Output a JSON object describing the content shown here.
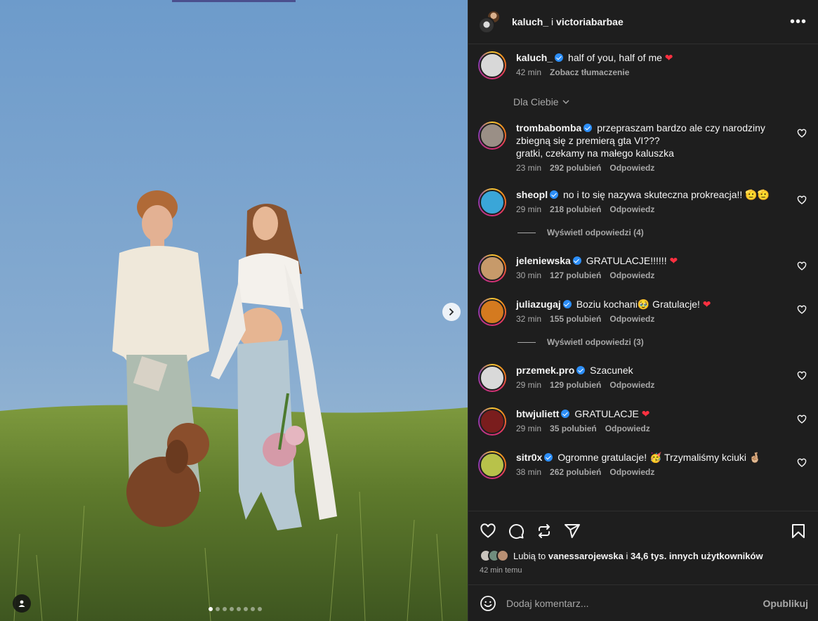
{
  "post": {
    "authors": [
      "kaluch_",
      "victoriabarbae"
    ],
    "authors_joiner": "i",
    "more_icon": "more-horizontal-icon"
  },
  "caption": {
    "username": "kaluch_",
    "text": "half of you, half of me",
    "emoji": "❤",
    "time": "42 min",
    "translate": "Zobacz tłumaczenie"
  },
  "filter_label": "Dla Ciebie",
  "comments": [
    {
      "username": "trombabomba",
      "text": "przepraszam bardzo ale czy narodziny zbiegną się z premierą gta VI???",
      "text2": "gratki, czekamy na małego kaluszka",
      "time": "23 min",
      "likes": "292 polubień",
      "reply": "Odpowiedz",
      "avatar_color": "#9a8f86"
    },
    {
      "username": "sheopl",
      "text": "no i to się nazywa skuteczna prokreacja!! 🫡🫡",
      "time": "29 min",
      "likes": "218 polubień",
      "reply": "Odpowiedz",
      "view_replies": "Wyświetl odpowiedzi (4)",
      "avatar_color": "#3aa6d8"
    },
    {
      "username": "jeleniewska",
      "text": "GRATULACJE!!!!!!",
      "emoji": "❤",
      "time": "30 min",
      "likes": "127 polubień",
      "reply": "Odpowiedz",
      "avatar_color": "#c79a6a"
    },
    {
      "username": "juliazugaj",
      "text": "Boziu kochani🥹 Gratulacje!",
      "emoji": "❤",
      "time": "32 min",
      "likes": "155 polubień",
      "reply": "Odpowiedz",
      "view_replies": "Wyświetl odpowiedzi (3)",
      "avatar_color": "#d47a1f"
    },
    {
      "username": "przemek.pro",
      "text": "Szacunek",
      "time": "29 min",
      "likes": "129 polubień",
      "reply": "Odpowiedz",
      "avatar_color": "#d9d9d9"
    },
    {
      "username": "btwjuliett",
      "text": "GRATULACJE",
      "emoji": "❤",
      "time": "29 min",
      "likes": "35 polubień",
      "reply": "Odpowiedz",
      "avatar_color": "#7a1d1d"
    },
    {
      "username": "sitr0x",
      "text": "Ogromne gratulacje! 🥳 Trzymaliśmy kciuki 🤞🏼",
      "time": "38 min",
      "likes": "262 polubień",
      "reply": "Odpowiedz",
      "avatar_color": "#b8c24a"
    }
  ],
  "likes_line": {
    "prefix": "Lubią to",
    "user": "vanessarojewska",
    "joiner": "i",
    "others": "34,6 tys. innych użytkowników"
  },
  "posted_ago": "42 min temu",
  "composer": {
    "placeholder": "Dodaj komentarz...",
    "publish": "Opublikuj"
  },
  "carousel": {
    "total": 8,
    "current": 1
  },
  "colors": {
    "verified": "#2c8ef8",
    "heart": "#ff3040",
    "panel_bg": "#1e1e1e"
  }
}
